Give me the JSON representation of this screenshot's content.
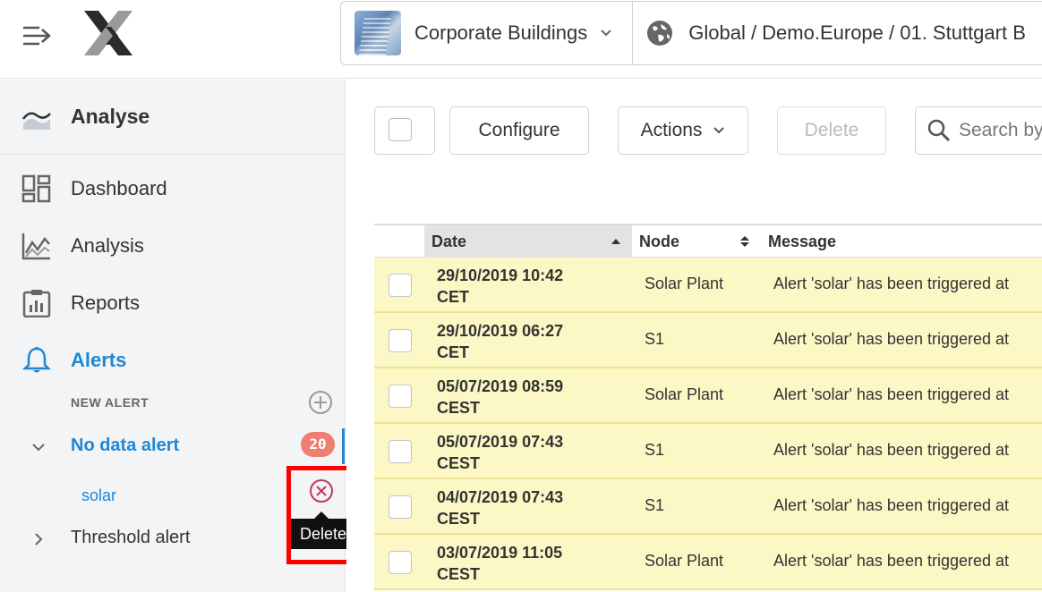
{
  "header": {
    "building": "Corporate Buildings",
    "path": "Global / Demo.Europe / 01. Stuttgart B"
  },
  "sidebar": {
    "section_title": "Analyse",
    "items": [
      {
        "label": "Dashboard"
      },
      {
        "label": "Analysis"
      },
      {
        "label": "Reports"
      },
      {
        "label": "Alerts"
      }
    ],
    "new_alert_label": "NEW ALERT",
    "tree": [
      {
        "label": "No data alert",
        "badge": "20",
        "children": [
          {
            "label": "solar"
          }
        ]
      },
      {
        "label": "Threshold alert"
      }
    ],
    "tooltip": "Delete"
  },
  "toolbar": {
    "configure": "Configure",
    "actions": "Actions",
    "delete": "Delete",
    "search_placeholder": "Search by"
  },
  "table": {
    "columns": [
      "Date",
      "Node",
      "Message"
    ],
    "rows": [
      {
        "date": "29/10/2019 10:42",
        "tz": "CET",
        "node": "Solar Plant",
        "message": "Alert 'solar' has been triggered at"
      },
      {
        "date": "29/10/2019 06:27",
        "tz": "CET",
        "node": "S1",
        "message": "Alert 'solar' has been triggered at"
      },
      {
        "date": "05/07/2019 08:59",
        "tz": "CEST",
        "node": "Solar Plant",
        "message": "Alert 'solar' has been triggered at"
      },
      {
        "date": "05/07/2019 07:43",
        "tz": "CEST",
        "node": "S1",
        "message": "Alert 'solar' has been triggered at"
      },
      {
        "date": "04/07/2019 07:43",
        "tz": "CEST",
        "node": "S1",
        "message": "Alert 'solar' has been triggered at"
      },
      {
        "date": "03/07/2019 11:05",
        "tz": "CEST",
        "node": "Solar Plant",
        "message": "Alert 'solar' has been triggered at"
      }
    ]
  },
  "colors": {
    "accent": "#1f86d6",
    "row_highlight": "#fcf8c6",
    "badge": "#f07d72",
    "delete_icon": "#c0395a"
  }
}
